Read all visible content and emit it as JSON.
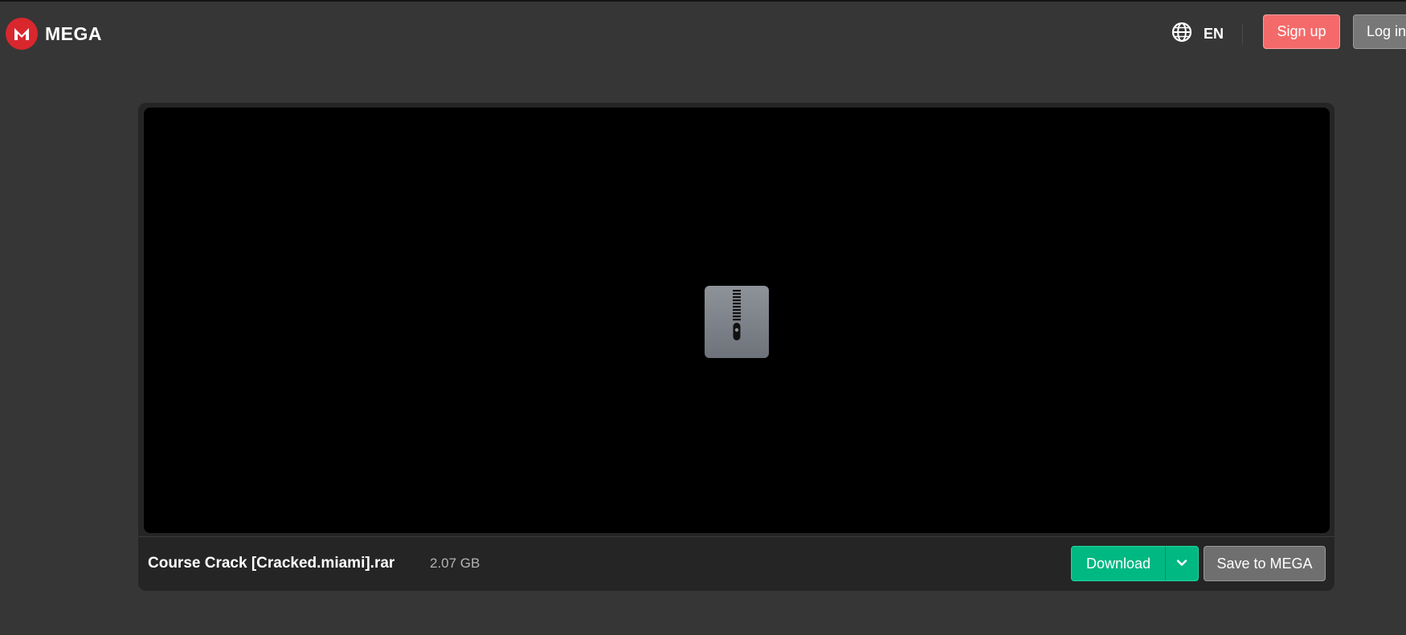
{
  "header": {
    "brand": "MEGA",
    "language": "EN",
    "signup_label": "Sign up",
    "login_label": "Log in"
  },
  "file": {
    "name": "Course Crack [Cracked.miami].rar",
    "size": "2.07 GB",
    "icon": "zip-archive-icon"
  },
  "actions": {
    "download_label": "Download",
    "save_label": "Save to MEGA"
  },
  "colors": {
    "brand_red": "#d9272e",
    "signup_bg": "#f46a6a",
    "download_green": "#00b882",
    "background": "#363636"
  }
}
